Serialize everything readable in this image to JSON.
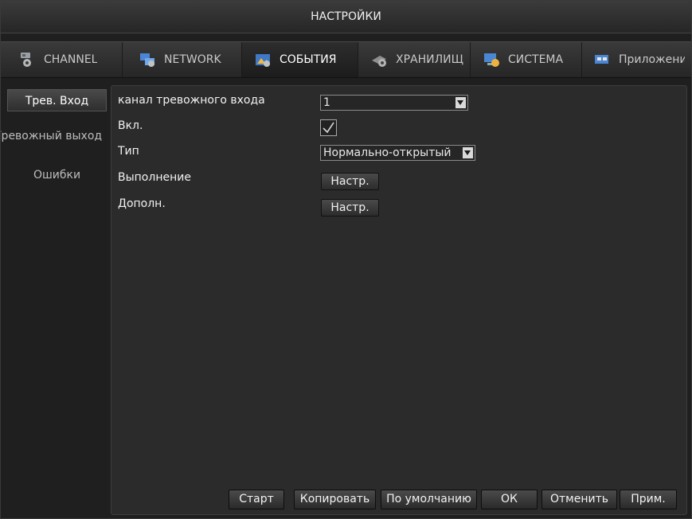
{
  "window": {
    "title": "НАСТРОЙКИ"
  },
  "tabs": [
    {
      "label": "CHANNEL",
      "icon": "camera-gear-icon"
    },
    {
      "label": "NETWORK",
      "icon": "network-icon"
    },
    {
      "label": "СОБЫТИЯ",
      "icon": "events-icon",
      "active": true
    },
    {
      "label": "ХРАНИЛИЩЕ",
      "icon": "storage-icon"
    },
    {
      "label": "СИСТЕМА",
      "icon": "system-icon"
    },
    {
      "label": "Приложени",
      "icon": "apps-icon"
    }
  ],
  "sidebar": {
    "items": [
      {
        "label": "Трев. Вход",
        "active": true
      },
      {
        "label": "Тревожный выход"
      },
      {
        "label": "Ошибки"
      }
    ]
  },
  "form": {
    "channel_label": "канал тревожного входа",
    "channel_value": "1",
    "enable_label": "Вкл.",
    "enable_checked": true,
    "type_label": "Тип",
    "type_value": "Нормально-открытый",
    "exec_label": "Выполнение",
    "exec_button": "Настр.",
    "extra_label": "Дополн.",
    "extra_button": "Настр."
  },
  "footer": {
    "start": "Старт",
    "copy": "Копировать",
    "default": "По умолчанию",
    "ok": "ОК",
    "cancel": "Отменить",
    "apply": "Прим."
  },
  "colors": {
    "background": "#1f1f1f",
    "panel": "#2b2b2b",
    "text": "#f2f2f2"
  }
}
